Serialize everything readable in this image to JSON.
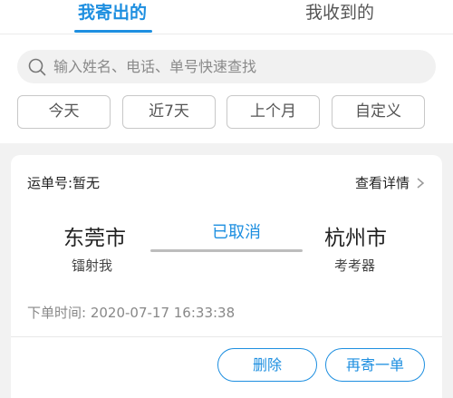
{
  "tabs": {
    "sent": "我寄出的",
    "received": "我收到的"
  },
  "search": {
    "placeholder": "输入姓名、电话、单号快速查找"
  },
  "filters": [
    "今天",
    "近7天",
    "上个月",
    "自定义"
  ],
  "order": {
    "waybill": "运单号:暂无",
    "details": "查看详情",
    "from_city": "东莞市",
    "from_name": "镭射我",
    "status": "已取消",
    "to_city": "杭州市",
    "to_name": "考考器",
    "order_time": "下单时间:  2020-07-17 16:33:38",
    "delete_label": "删除",
    "resend_label": "再寄一单"
  },
  "colors": {
    "accent": "#1e8fe0",
    "background": "#f2f2f2"
  },
  "icons": {
    "search": "search-icon",
    "details": "chevron-right-icon"
  }
}
